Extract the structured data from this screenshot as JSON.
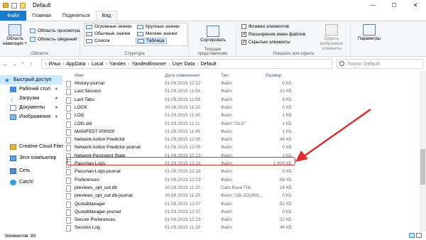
{
  "window": {
    "title": "Default",
    "minimize": "—",
    "maximize": "☐",
    "close": "✕"
  },
  "tabs": [
    {
      "label": "Файл"
    },
    {
      "label": "Главная"
    },
    {
      "label": "Поделиться"
    },
    {
      "label": "Вид"
    }
  ],
  "ribbon": {
    "panels": {
      "nav_pane": "Область навигации ˅",
      "preview": "Область просмотра",
      "details": "Область сведений",
      "group_label": "Области"
    },
    "layout": {
      "items": [
        "Огромные значки",
        "Крупные значки",
        "Обычные значки",
        "Мелкие значки",
        "Список",
        "Таблица"
      ],
      "group_label": "Структура"
    },
    "current_view": {
      "sort": "Сортировать",
      "group_label": "Текущее представление"
    },
    "show_hide": {
      "checkbox_items": "Флажки элементов",
      "extensions": "Расширения имен файлов",
      "hidden": "Скрытые элементы",
      "hide_selected": "Скрыть выбранные элементы",
      "group_label": "Показать или скрыть"
    },
    "options": "Параметры"
  },
  "address": {
    "crumbs": [
      "Илья",
      "AppData",
      "Local",
      "Yandex",
      "YandexBrowser",
      "User Data",
      "Default"
    ],
    "search_placeholder": "Поиск: Default"
  },
  "nav": [
    {
      "label": "Быстрый доступ",
      "icon": "star-icon"
    },
    {
      "label": "Рабочий стол",
      "icon": "desktop-icon"
    },
    {
      "label": "Загрузки",
      "icon": "download-icon"
    },
    {
      "label": "Документы",
      "icon": "documents-icon"
    },
    {
      "label": "Изображения",
      "icon": "pictures-icon"
    },
    {
      "label": "Creative Cloud Files",
      "icon": "creative-cloud-icon"
    },
    {
      "label": "Этот компьютер",
      "icon": "computer-icon"
    },
    {
      "label": "Сеть",
      "icon": "network-icon"
    },
    {
      "label": "Catch!",
      "icon": "catch-icon"
    }
  ],
  "pin": "★",
  "columns": [
    "Имя",
    "Дата изменения",
    "Тип",
    "Размер"
  ],
  "files": [
    {
      "name": "History-journal",
      "date": "01.09.2019 12:22",
      "type": "Файл",
      "size": "0 КБ"
    },
    {
      "name": "Last Session",
      "date": "01.09.2019 11:56",
      "type": "Файл",
      "size": "32 КБ"
    },
    {
      "name": "Last Tabs",
      "date": "01.09.2019 11:56",
      "type": "Файл",
      "size": "8 КБ"
    },
    {
      "name": "LOCK",
      "date": "30.08.2019 11:20",
      "type": "Файл",
      "size": "0 КБ"
    },
    {
      "name": "LOG",
      "date": "01.09.2019 11:45",
      "type": "Файл",
      "size": "1 КБ"
    },
    {
      "name": "LOG.old",
      "date": "01.09.2019 11:11",
      "type": "Файл \"OLD\"",
      "size": "1 КБ"
    },
    {
      "name": "MANIFEST-000020",
      "date": "01.09.2019 11:45",
      "type": "Файл",
      "size": "1 КБ"
    },
    {
      "name": "Network Action Predictor",
      "date": "01.09.2019 12:05",
      "type": "Файл",
      "size": "44 КБ"
    },
    {
      "name": "Network Action Predictor-journal",
      "date": "01.09.2019 12:05",
      "type": "Файл",
      "size": "0 КБ"
    },
    {
      "name": "Network Persistent State",
      "date": "01.09.2019 12:23",
      "type": "Файл",
      "size": "2 КБ"
    },
    {
      "name": "Passman Logs",
      "date": "01.09.2019 12:18",
      "type": "Файл",
      "size": "1 600 КБ"
    },
    {
      "name": "Passman Logs-journal",
      "date": "01.09.2019 12:18",
      "type": "Файл",
      "size": "0 КБ"
    },
    {
      "name": "Preferences",
      "date": "01.09.2019 12:23",
      "type": "Файл",
      "size": "66 КБ"
    },
    {
      "name": "previews_opt_out.db",
      "date": "30.08.2019 11:20",
      "type": "Data Base File",
      "size": "16 КБ"
    },
    {
      "name": "previews_opt_out.db-journal",
      "date": "30.08.2019 11:20",
      "type": "Файл \"DB-JOURN...",
      "size": "0 КБ"
    },
    {
      "name": "QuotaManager",
      "date": "01.09.2019 12:07",
      "type": "Файл",
      "size": "52 КБ"
    },
    {
      "name": "QuotaManager-journal",
      "date": "01.09.2019 12:07",
      "type": "Файл",
      "size": "0 КБ"
    },
    {
      "name": "Secure Preferences",
      "date": "01.09.2019 12:23",
      "type": "Файл",
      "size": "32 КБ"
    },
    {
      "name": "Session Log",
      "date": "01.09.2019 11:39",
      "type": "Файл",
      "size": "46 КБ"
    }
  ],
  "status": {
    "items": "Элементов: 80"
  },
  "colors": {
    "accent": "#1979ca",
    "selection": "#cce8ff",
    "highlight": "#e32b2b"
  }
}
